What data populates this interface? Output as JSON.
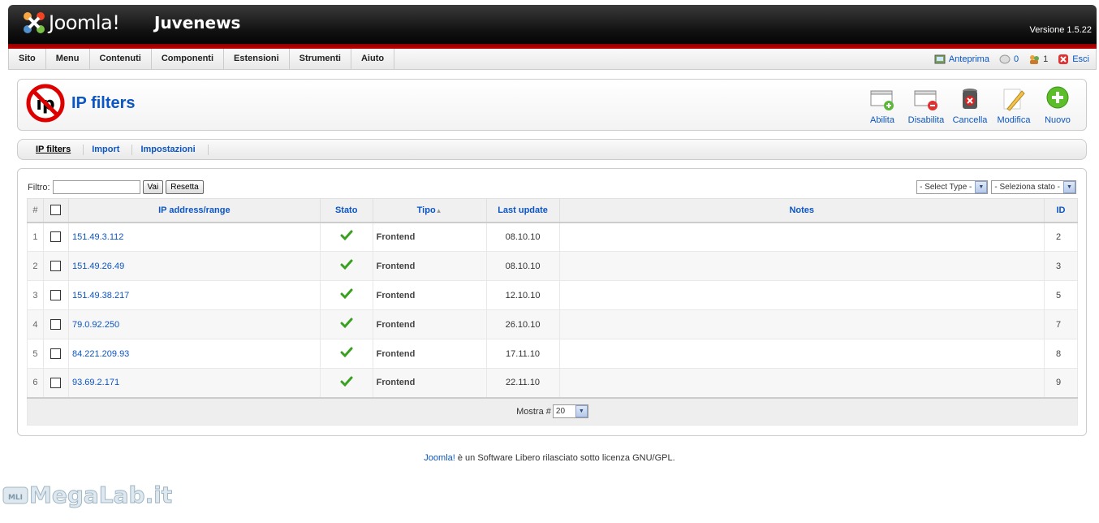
{
  "header": {
    "brand": "Joomla!",
    "site_name": "Juvenews",
    "version": "Versione 1.5.22"
  },
  "menu": [
    "Sito",
    "Menu",
    "Contenuti",
    "Componenti",
    "Estensioni",
    "Strumenti",
    "Aiuto"
  ],
  "status": {
    "preview": "Anteprima",
    "messages": "0",
    "users": "1",
    "logout": "Esci"
  },
  "page": {
    "title": "IP filters"
  },
  "toolbar": {
    "enable": "Abilita",
    "disable": "Disabilita",
    "delete": "Cancella",
    "edit": "Modifica",
    "new": "Nuovo"
  },
  "submenu": [
    "IP filters",
    "Import",
    "Impostazioni"
  ],
  "filter": {
    "label": "Filtro:",
    "value": "",
    "go": "Vai",
    "reset": "Resetta",
    "type_select": "- Select Type -",
    "state_select": "- Seleziona stato -"
  },
  "table": {
    "headers": {
      "num": "#",
      "ip": "IP address/range",
      "state": "Stato",
      "type": "Tipo",
      "updated": "Last update",
      "notes": "Notes",
      "id": "ID"
    },
    "rows": [
      {
        "num": "1",
        "ip": "151.49.3.112",
        "type": "Frontend",
        "updated": "08.10.10",
        "notes": "",
        "id": "2"
      },
      {
        "num": "2",
        "ip": "151.49.26.49",
        "type": "Frontend",
        "updated": "08.10.10",
        "notes": "",
        "id": "3"
      },
      {
        "num": "3",
        "ip": "151.49.38.217",
        "type": "Frontend",
        "updated": "12.10.10",
        "notes": "",
        "id": "5"
      },
      {
        "num": "4",
        "ip": "79.0.92.250",
        "type": "Frontend",
        "updated": "26.10.10",
        "notes": "",
        "id": "7"
      },
      {
        "num": "5",
        "ip": "84.221.209.93",
        "type": "Frontend",
        "updated": "17.11.10",
        "notes": "",
        "id": "8"
      },
      {
        "num": "6",
        "ip": "93.69.2.171",
        "type": "Frontend",
        "updated": "22.11.10",
        "notes": "",
        "id": "9"
      }
    ]
  },
  "pagination": {
    "label": "Mostra #",
    "limit": "20"
  },
  "footer": {
    "link": "Joomla!",
    "text": " è un Software Libero rilasciato sotto licenza GNU/GPL."
  },
  "watermark": {
    "badge": "MLI",
    "text": "MegaLab.it"
  },
  "colors": {
    "link": "#0b55c4",
    "header_red": "#c00000",
    "check_green": "#3aa021"
  }
}
